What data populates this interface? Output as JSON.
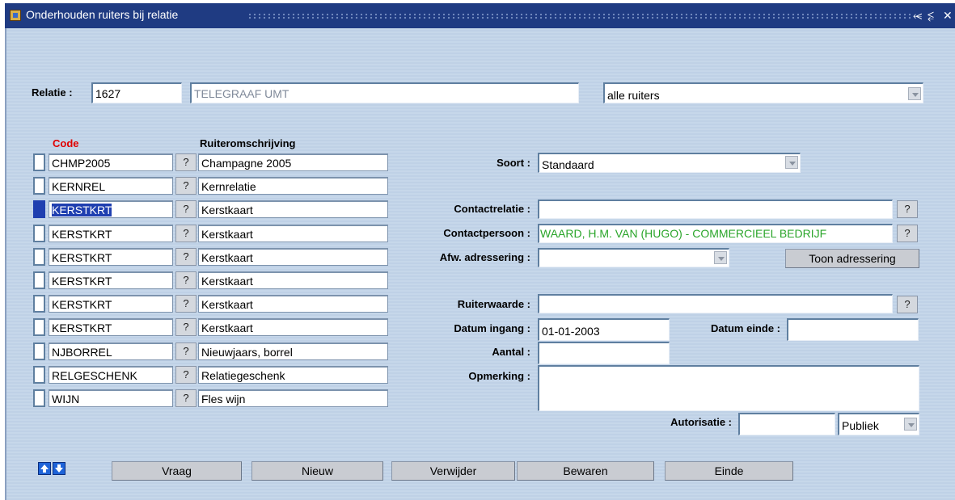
{
  "window": {
    "title": "Onderhouden ruiters bij relatie",
    "title_buttons": [
      "⥷",
      "⥶",
      "✕"
    ]
  },
  "relatie": {
    "label": "Relatie :",
    "number": "1627",
    "name": "TELEGRAAF UMT",
    "filter": "alle ruiters"
  },
  "table": {
    "headers": {
      "code": "Code",
      "description": "Ruiteromschrijving"
    },
    "help_glyph": "?",
    "rows": [
      {
        "code": "CHMP2005",
        "description": "Champagne 2005",
        "active": false
      },
      {
        "code": "KERNREL",
        "description": "Kernrelatie",
        "active": false
      },
      {
        "code": "KERSTKRT",
        "description": "Kerstkaart",
        "active": true
      },
      {
        "code": "KERSTKRT",
        "description": "Kerstkaart",
        "active": false
      },
      {
        "code": "KERSTKRT",
        "description": "Kerstkaart",
        "active": false
      },
      {
        "code": "KERSTKRT",
        "description": "Kerstkaart",
        "active": false
      },
      {
        "code": "KERSTKRT",
        "description": "Kerstkaart",
        "active": false
      },
      {
        "code": "KERSTKRT",
        "description": "Kerstkaart",
        "active": false
      },
      {
        "code": "NJBORREL",
        "description": "Nieuwjaars, borrel",
        "active": false
      },
      {
        "code": "RELGESCHENK",
        "description": "Relatiegeschenk",
        "active": false
      },
      {
        "code": "WIJN",
        "description": "Fles wijn",
        "active": false
      }
    ]
  },
  "detail": {
    "soort": {
      "label": "Soort :",
      "value": "Standaard"
    },
    "contactrelatie": {
      "label": "Contactrelatie :",
      "value": ""
    },
    "contactpersoon": {
      "label": "Contactpersoon :",
      "value": "WAARD, H.M. VAN (HUGO) - COMMERCIEEL BEDRIJF"
    },
    "afw_adressering": {
      "label": "Afw. adressering :",
      "value": ""
    },
    "toon_adressering_label": "Toon adressering",
    "ruiterwaarde": {
      "label": "Ruiterwaarde :",
      "value": ""
    },
    "datum_ingang": {
      "label": "Datum ingang :",
      "value": "01-01-2003"
    },
    "datum_einde": {
      "label": "Datum einde :",
      "value": ""
    },
    "aantal": {
      "label": "Aantal :",
      "value": ""
    },
    "opmerking": {
      "label": "Opmerking :",
      "value": ""
    },
    "autorisatie": {
      "label": "Autorisatie :",
      "value": "",
      "visibility": "Publiek"
    }
  },
  "buttons": {
    "vraag": "Vraag",
    "nieuw": "Nieuw",
    "verwijder": "Verwijder",
    "bewaren": "Bewaren",
    "einde": "Einde"
  },
  "colors": {
    "titlebar": "#1f3b82",
    "panel": "#bfd1e6",
    "code_header": "#e00000",
    "selection": "#1f3fb0",
    "green_text": "#2aa52a"
  }
}
